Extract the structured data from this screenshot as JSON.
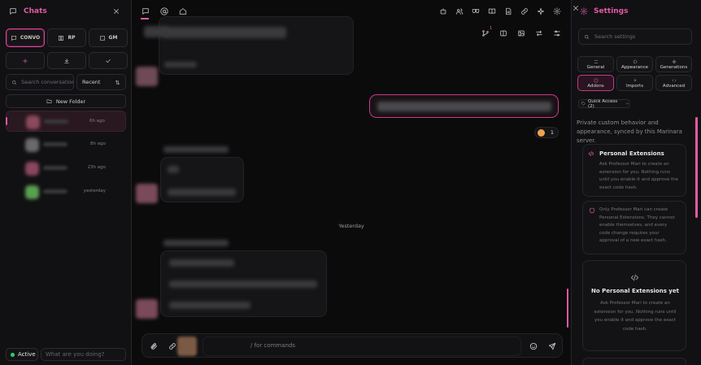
{
  "left": {
    "title": "Chats",
    "modes": [
      {
        "label": "CONVO",
        "icon": "chat-bubble-icon",
        "active": true
      },
      {
        "label": "RP",
        "icon": "book-icon",
        "active": false
      },
      {
        "label": "GM",
        "icon": "dice-icon",
        "active": false
      }
    ],
    "actions": [
      {
        "name": "new-chat-button",
        "icon": "plus-icon"
      },
      {
        "name": "import-chat-button",
        "icon": "download-icon"
      },
      {
        "name": "select-chats-button",
        "icon": "check-icon"
      }
    ],
    "search_placeholder": "Search conversations",
    "sort_label": "Recent",
    "new_folder_label": "New Folder",
    "chats": [
      {
        "time": "6h ago",
        "selected": true,
        "avatar_color": "#8a4a5a"
      },
      {
        "time": "8h ago",
        "selected": false,
        "avatar_color": "#6a6a6a"
      },
      {
        "time": "23h ago",
        "selected": false,
        "avatar_color": "#8a4660"
      },
      {
        "time": "yesterday",
        "selected": false,
        "avatar_color": "#5aa050"
      }
    ],
    "status_label": "Active",
    "status_placeholder": "What are you doing?"
  },
  "chat": {
    "toolbar_icons_left": [
      "chat-icon",
      "mention-icon",
      "home-icon"
    ],
    "toolbar_icons_right": [
      "robot-icon",
      "users-icon",
      "masks-icon",
      "book-open-icon",
      "document-icon",
      "link-icon",
      "sparkle-icon",
      "settings-icon"
    ],
    "secondary_icons": [
      "branch-icon",
      "columns-icon",
      "image-icon",
      "swap-icon",
      "sliders-icon"
    ],
    "branch_badge": "1",
    "reaction_count": "1",
    "day_separator": "Yesterday",
    "composer_placeholder": "/ for commands"
  },
  "right": {
    "title": "Settings",
    "search_placeholder": "Search settings",
    "tabs": [
      {
        "label": "General",
        "icon": "sliders-icon",
        "active": false
      },
      {
        "label": "Appearance",
        "icon": "palette-icon",
        "active": false
      },
      {
        "label": "Generations",
        "icon": "sparkle-icon",
        "active": false
      },
      {
        "label": "Addons",
        "icon": "puzzle-icon",
        "active": true
      },
      {
        "label": "Imports",
        "icon": "download-icon",
        "active": false
      },
      {
        "label": "Advanced",
        "icon": "code-icon",
        "active": false
      }
    ],
    "quick_access": "Quick Access (2)",
    "description": "Private custom behavior and appearance, synced by this Marinara server.",
    "extensions_card": {
      "title": "Personal Extensions",
      "body": "Ask Professor Mari to create an extension for you. Nothing runs until you enable it and approve the exact code hash."
    },
    "warning_card": {
      "body": "Only Professor Mari can create Personal Extensions. They cannot enable themselves, and every code change requires your approval of a new exact hash."
    },
    "empty_card": {
      "title": "No Personal Extensions yet",
      "body": "Ask Professor Mari to create an extension for you. Nothing runs until you enable it and approve the exact code hash."
    }
  }
}
